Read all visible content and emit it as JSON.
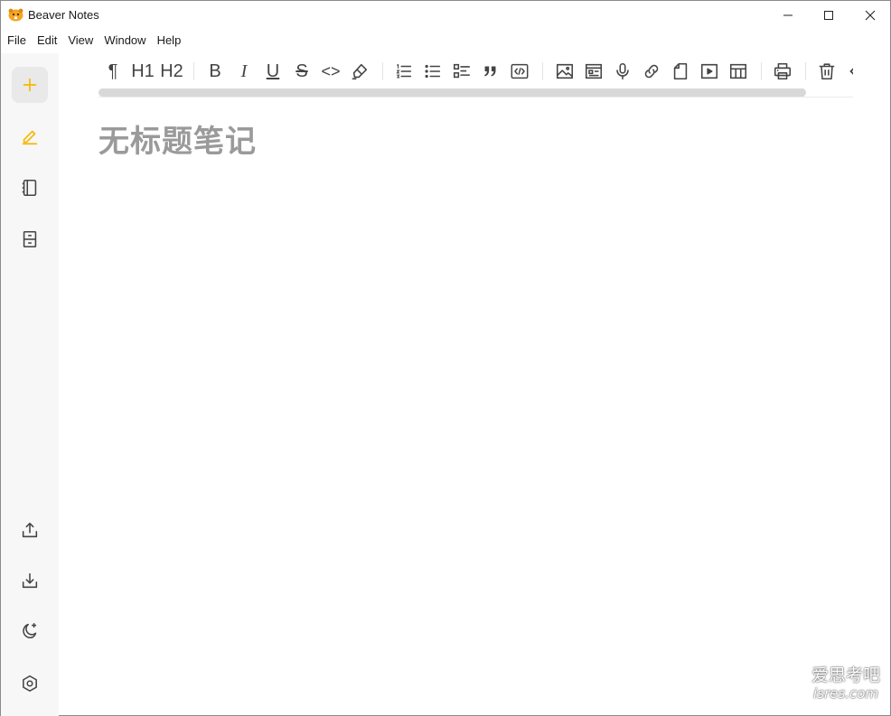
{
  "window": {
    "title": "Beaver Notes"
  },
  "menu": [
    "File",
    "Edit",
    "View",
    "Window",
    "Help"
  ],
  "sidebar": {
    "top": [
      {
        "name": "new-note",
        "icon": "plus-icon",
        "active": true
      },
      {
        "name": "notes",
        "icon": "pencil-icon",
        "active": false
      },
      {
        "name": "notebooks",
        "icon": "notebook-icon",
        "active": false
      },
      {
        "name": "archive",
        "icon": "archive-icon",
        "active": false
      }
    ],
    "bottom": [
      {
        "name": "export",
        "icon": "upload-icon"
      },
      {
        "name": "import",
        "icon": "download-icon"
      },
      {
        "name": "theme",
        "icon": "moon-icon"
      },
      {
        "name": "settings",
        "icon": "gear-icon"
      }
    ]
  },
  "toolbar": {
    "paragraph": "¶",
    "h1": "H1",
    "h2": "H2",
    "bold": "B",
    "italic": "I",
    "underline": "U",
    "strike": "S",
    "code": "<>"
  },
  "editor": {
    "title": "无标题笔记"
  },
  "watermark": {
    "line1": "爱思考吧",
    "line2": "isres.com"
  },
  "colors": {
    "accent": "#f5b800",
    "sidebar_bg": "#f7f7f7",
    "active_bg": "#e9e9e9",
    "title_placeholder": "#9a9a9a"
  }
}
